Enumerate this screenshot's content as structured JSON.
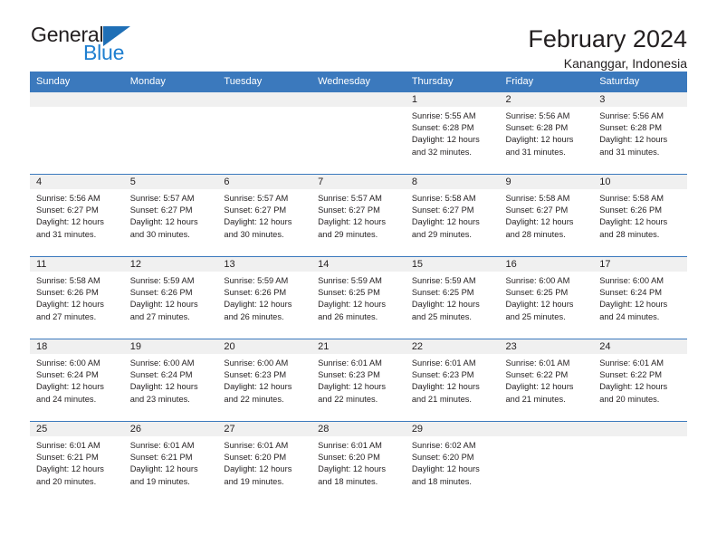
{
  "brand": {
    "name_top": "General",
    "name_bottom": "Blue",
    "accent_color": "#1f7fd0",
    "triangle_color": "#1f6fb6"
  },
  "header": {
    "title": "February 2024",
    "subtitle": "Kananggar, Indonesia"
  },
  "calendar": {
    "header_bg": "#3b79bd",
    "daynum_bg": "#f0f0f0",
    "weekday_headers": [
      "Sunday",
      "Monday",
      "Tuesday",
      "Wednesday",
      "Thursday",
      "Friday",
      "Saturday"
    ],
    "weeks": [
      [
        {
          "day": "",
          "sunrise": "",
          "sunset": "",
          "daylight_line1": "",
          "daylight_line2": "",
          "empty": true
        },
        {
          "day": "",
          "sunrise": "",
          "sunset": "",
          "daylight_line1": "",
          "daylight_line2": "",
          "empty": true
        },
        {
          "day": "",
          "sunrise": "",
          "sunset": "",
          "daylight_line1": "",
          "daylight_line2": "",
          "empty": true
        },
        {
          "day": "",
          "sunrise": "",
          "sunset": "",
          "daylight_line1": "",
          "daylight_line2": "",
          "empty": true
        },
        {
          "day": "1",
          "sunrise": "Sunrise: 5:55 AM",
          "sunset": "Sunset: 6:28 PM",
          "daylight_line1": "Daylight: 12 hours",
          "daylight_line2": "and 32 minutes.",
          "empty": false
        },
        {
          "day": "2",
          "sunrise": "Sunrise: 5:56 AM",
          "sunset": "Sunset: 6:28 PM",
          "daylight_line1": "Daylight: 12 hours",
          "daylight_line2": "and 31 minutes.",
          "empty": false
        },
        {
          "day": "3",
          "sunrise": "Sunrise: 5:56 AM",
          "sunset": "Sunset: 6:28 PM",
          "daylight_line1": "Daylight: 12 hours",
          "daylight_line2": "and 31 minutes.",
          "empty": false
        }
      ],
      [
        {
          "day": "4",
          "sunrise": "Sunrise: 5:56 AM",
          "sunset": "Sunset: 6:27 PM",
          "daylight_line1": "Daylight: 12 hours",
          "daylight_line2": "and 31 minutes.",
          "empty": false
        },
        {
          "day": "5",
          "sunrise": "Sunrise: 5:57 AM",
          "sunset": "Sunset: 6:27 PM",
          "daylight_line1": "Daylight: 12 hours",
          "daylight_line2": "and 30 minutes.",
          "empty": false
        },
        {
          "day": "6",
          "sunrise": "Sunrise: 5:57 AM",
          "sunset": "Sunset: 6:27 PM",
          "daylight_line1": "Daylight: 12 hours",
          "daylight_line2": "and 30 minutes.",
          "empty": false
        },
        {
          "day": "7",
          "sunrise": "Sunrise: 5:57 AM",
          "sunset": "Sunset: 6:27 PM",
          "daylight_line1": "Daylight: 12 hours",
          "daylight_line2": "and 29 minutes.",
          "empty": false
        },
        {
          "day": "8",
          "sunrise": "Sunrise: 5:58 AM",
          "sunset": "Sunset: 6:27 PM",
          "daylight_line1": "Daylight: 12 hours",
          "daylight_line2": "and 29 minutes.",
          "empty": false
        },
        {
          "day": "9",
          "sunrise": "Sunrise: 5:58 AM",
          "sunset": "Sunset: 6:27 PM",
          "daylight_line1": "Daylight: 12 hours",
          "daylight_line2": "and 28 minutes.",
          "empty": false
        },
        {
          "day": "10",
          "sunrise": "Sunrise: 5:58 AM",
          "sunset": "Sunset: 6:26 PM",
          "daylight_line1": "Daylight: 12 hours",
          "daylight_line2": "and 28 minutes.",
          "empty": false
        }
      ],
      [
        {
          "day": "11",
          "sunrise": "Sunrise: 5:58 AM",
          "sunset": "Sunset: 6:26 PM",
          "daylight_line1": "Daylight: 12 hours",
          "daylight_line2": "and 27 minutes.",
          "empty": false
        },
        {
          "day": "12",
          "sunrise": "Sunrise: 5:59 AM",
          "sunset": "Sunset: 6:26 PM",
          "daylight_line1": "Daylight: 12 hours",
          "daylight_line2": "and 27 minutes.",
          "empty": false
        },
        {
          "day": "13",
          "sunrise": "Sunrise: 5:59 AM",
          "sunset": "Sunset: 6:26 PM",
          "daylight_line1": "Daylight: 12 hours",
          "daylight_line2": "and 26 minutes.",
          "empty": false
        },
        {
          "day": "14",
          "sunrise": "Sunrise: 5:59 AM",
          "sunset": "Sunset: 6:25 PM",
          "daylight_line1": "Daylight: 12 hours",
          "daylight_line2": "and 26 minutes.",
          "empty": false
        },
        {
          "day": "15",
          "sunrise": "Sunrise: 5:59 AM",
          "sunset": "Sunset: 6:25 PM",
          "daylight_line1": "Daylight: 12 hours",
          "daylight_line2": "and 25 minutes.",
          "empty": false
        },
        {
          "day": "16",
          "sunrise": "Sunrise: 6:00 AM",
          "sunset": "Sunset: 6:25 PM",
          "daylight_line1": "Daylight: 12 hours",
          "daylight_line2": "and 25 minutes.",
          "empty": false
        },
        {
          "day": "17",
          "sunrise": "Sunrise: 6:00 AM",
          "sunset": "Sunset: 6:24 PM",
          "daylight_line1": "Daylight: 12 hours",
          "daylight_line2": "and 24 minutes.",
          "empty": false
        }
      ],
      [
        {
          "day": "18",
          "sunrise": "Sunrise: 6:00 AM",
          "sunset": "Sunset: 6:24 PM",
          "daylight_line1": "Daylight: 12 hours",
          "daylight_line2": "and 24 minutes.",
          "empty": false
        },
        {
          "day": "19",
          "sunrise": "Sunrise: 6:00 AM",
          "sunset": "Sunset: 6:24 PM",
          "daylight_line1": "Daylight: 12 hours",
          "daylight_line2": "and 23 minutes.",
          "empty": false
        },
        {
          "day": "20",
          "sunrise": "Sunrise: 6:00 AM",
          "sunset": "Sunset: 6:23 PM",
          "daylight_line1": "Daylight: 12 hours",
          "daylight_line2": "and 22 minutes.",
          "empty": false
        },
        {
          "day": "21",
          "sunrise": "Sunrise: 6:01 AM",
          "sunset": "Sunset: 6:23 PM",
          "daylight_line1": "Daylight: 12 hours",
          "daylight_line2": "and 22 minutes.",
          "empty": false
        },
        {
          "day": "22",
          "sunrise": "Sunrise: 6:01 AM",
          "sunset": "Sunset: 6:23 PM",
          "daylight_line1": "Daylight: 12 hours",
          "daylight_line2": "and 21 minutes.",
          "empty": false
        },
        {
          "day": "23",
          "sunrise": "Sunrise: 6:01 AM",
          "sunset": "Sunset: 6:22 PM",
          "daylight_line1": "Daylight: 12 hours",
          "daylight_line2": "and 21 minutes.",
          "empty": false
        },
        {
          "day": "24",
          "sunrise": "Sunrise: 6:01 AM",
          "sunset": "Sunset: 6:22 PM",
          "daylight_line1": "Daylight: 12 hours",
          "daylight_line2": "and 20 minutes.",
          "empty": false
        }
      ],
      [
        {
          "day": "25",
          "sunrise": "Sunrise: 6:01 AM",
          "sunset": "Sunset: 6:21 PM",
          "daylight_line1": "Daylight: 12 hours",
          "daylight_line2": "and 20 minutes.",
          "empty": false
        },
        {
          "day": "26",
          "sunrise": "Sunrise: 6:01 AM",
          "sunset": "Sunset: 6:21 PM",
          "daylight_line1": "Daylight: 12 hours",
          "daylight_line2": "and 19 minutes.",
          "empty": false
        },
        {
          "day": "27",
          "sunrise": "Sunrise: 6:01 AM",
          "sunset": "Sunset: 6:20 PM",
          "daylight_line1": "Daylight: 12 hours",
          "daylight_line2": "and 19 minutes.",
          "empty": false
        },
        {
          "day": "28",
          "sunrise": "Sunrise: 6:01 AM",
          "sunset": "Sunset: 6:20 PM",
          "daylight_line1": "Daylight: 12 hours",
          "daylight_line2": "and 18 minutes.",
          "empty": false
        },
        {
          "day": "29",
          "sunrise": "Sunrise: 6:02 AM",
          "sunset": "Sunset: 6:20 PM",
          "daylight_line1": "Daylight: 12 hours",
          "daylight_line2": "and 18 minutes.",
          "empty": false
        },
        {
          "day": "",
          "sunrise": "",
          "sunset": "",
          "daylight_line1": "",
          "daylight_line2": "",
          "empty": true
        },
        {
          "day": "",
          "sunrise": "",
          "sunset": "",
          "daylight_line1": "",
          "daylight_line2": "",
          "empty": true
        }
      ]
    ]
  }
}
